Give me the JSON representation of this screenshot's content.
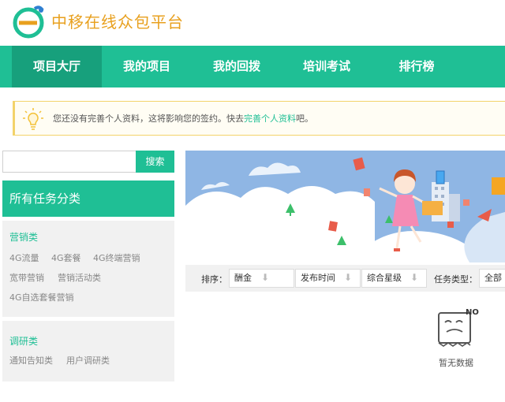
{
  "brand": {
    "logo_letter": "e",
    "name": "中移在线众包平台"
  },
  "nav": {
    "items": [
      {
        "label": "项目大厅",
        "active": true
      },
      {
        "label": "我的项目",
        "active": false
      },
      {
        "label": "我的回拨",
        "active": false
      },
      {
        "label": "培训考试",
        "active": false
      },
      {
        "label": "排行榜",
        "active": false
      }
    ]
  },
  "notice": {
    "text_before": "您还没有完善个人资料，这将影响您的签约。快去",
    "link_text": "完善个人资料",
    "text_after": "吧。"
  },
  "search": {
    "placeholder": "",
    "button_label": "搜索"
  },
  "categories": {
    "header": "所有任务分类",
    "groups": [
      {
        "title": "营销类",
        "items": [
          "4G流量",
          "4G套餐",
          "4G终端营销",
          "宽带营销",
          "营销活动类",
          "4G自选套餐营销"
        ]
      },
      {
        "title": "调研类",
        "items": [
          "通知告知类",
          "用户调研类"
        ]
      }
    ]
  },
  "sort": {
    "label": "排序：",
    "options": [
      "酬金",
      "发布时间",
      "综合星级"
    ],
    "type_label": "任务类型：",
    "type_value": "全部"
  },
  "empty": {
    "badge": "NO",
    "text": "暂无数据"
  },
  "colors": {
    "primary": "#1fbf95",
    "primary_dark": "#17a07c",
    "brand_text": "#e8a01e",
    "notice_border": "#f3d36a"
  }
}
